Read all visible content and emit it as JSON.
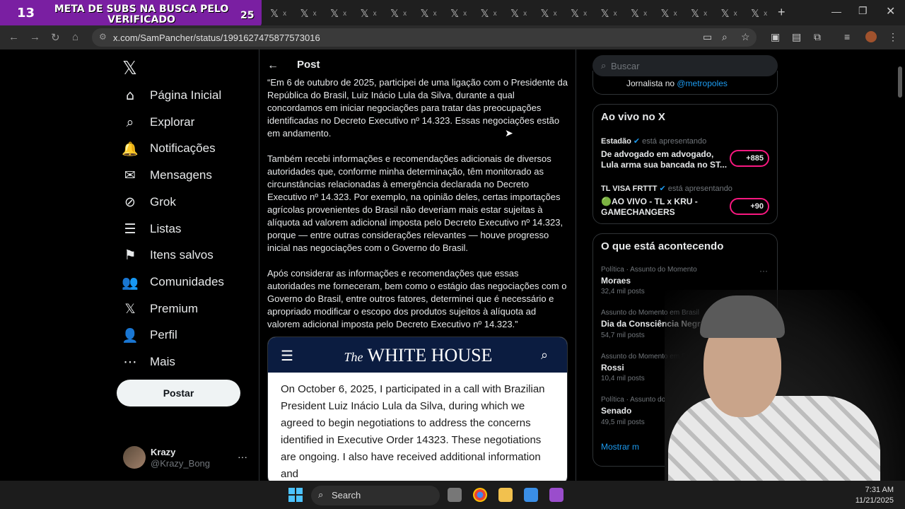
{
  "overlay": {
    "count": "13",
    "text": "META DE SUBS NA BUSCA PELO VERIFICADO",
    "goal": "25"
  },
  "tabs": {
    "icon": "x-logo-icon",
    "close": "x"
  },
  "browser": {
    "url": "x.com/SamPancher/status/1991627475877573016",
    "new_tab": "+",
    "icons": [
      "back-icon",
      "forward-icon",
      "reload-icon",
      "home-icon",
      "site-info-icon",
      "cast-icon",
      "zoom-icon",
      "star-icon",
      "extension-icon",
      "extension-icon",
      "puzzle-icon",
      "media-icon",
      "profile-icon",
      "menu-icon"
    ]
  },
  "sidebar": {
    "logo": "𝕏",
    "items": [
      {
        "label": "Página Inicial",
        "icon": "⌂"
      },
      {
        "label": "Explorar",
        "icon": "⌕"
      },
      {
        "label": "Notificações",
        "icon": "🔔"
      },
      {
        "label": "Mensagens",
        "icon": "✉"
      },
      {
        "label": "Grok",
        "icon": "⊘"
      },
      {
        "label": "Listas",
        "icon": "☰"
      },
      {
        "label": "Itens salvos",
        "icon": "⚑"
      },
      {
        "label": "Comunidades",
        "icon": "👥"
      },
      {
        "label": "Premium",
        "icon": "𝕏"
      },
      {
        "label": "Perfil",
        "icon": "👤"
      },
      {
        "label": "Mais",
        "icon": "⋯"
      }
    ],
    "post_button": "Postar",
    "account": {
      "name": "Krazy",
      "handle": "@Krazy_Bong",
      "more": "···"
    }
  },
  "post": {
    "header": "Post",
    "paragraphs": [
      "“Em 6 de outubro de 2025, participei de uma ligação com o Presidente da República do Brasil, Luiz Inácio Lula da Silva, durante a qual concordamos em iniciar negociações para tratar das preocupações identificadas no Decreto Executivo nº 14.323. Essas negociações estão em andamento.",
      "Também recebi informações e recomendações adicionais de diversos autoridades que, conforme minha determinação, têm monitorado as circunstâncias relacionadas à emergência declarada no Decreto Executivo nº 14.323. Por exemplo, na opinião deles, certas importações agrícolas provenientes do Brasil não deveriam mais estar sujeitas à alíquota ad valorem adicional imposta pelo Decreto Executivo nº 14.323, porque — entre outras considerações relevantes — houve progresso inicial nas negociações com o Governo do Brasil.",
      "Após considerar as informações e recomendações que essas autoridades me forneceram, bem como o estágio das negociações com o Governo do Brasil, entre outros fatores, determinei que é necessário e apropriado modificar o escopo dos produtos sujeitos à alíquota ad valorem adicional imposta pelo Decreto Executivo nº 14.323.”"
    ],
    "card": {
      "title_prefix": "The",
      "title": "WHITE HOUSE",
      "body": "On October 6, 2025, I participated in a call with Brazilian President Luiz Inácio Lula da Silva, during which we agreed to begin negotiations to address the concerns identified in Executive Order 14323.  These negotiations are ongoing. I also have received additional information and"
    }
  },
  "right": {
    "search_placeholder": "Buscar",
    "bio": {
      "prefix": "Jornalista no ",
      "link": "@metropoles"
    },
    "live": {
      "title": "Ao vivo no X",
      "items": [
        {
          "host": "Estadão",
          "status": "está apresentando",
          "text": "De advogado em advogado, Lula arma sua bancada no ST...",
          "badge": "+885"
        },
        {
          "host": "TL VISA FRTTT",
          "status": "está apresentando",
          "text": "🟢AO VIVO - TL x KRU - GAMECHANGERS",
          "badge": "+90"
        }
      ]
    },
    "trends": {
      "title": "O que está acontecendo",
      "items": [
        {
          "category": "Política · Assunto do Momento",
          "name": "Moraes",
          "count": "32,4 mil posts"
        },
        {
          "category": "Assunto do Momento em Brasil",
          "name": "Dia da Consciência Negra",
          "count": "54,7 mil posts"
        },
        {
          "category": "Assunto do Momento em Brasil",
          "name": "Rossi",
          "count": "10,4 mil posts"
        },
        {
          "category": "Política · Assunto do Momento",
          "name": "Senado",
          "count": "49,5 mil posts"
        }
      ],
      "show_more": "Mostrar m"
    }
  },
  "taskbar": {
    "search": "Search",
    "time": "7:31 AM",
    "date": "11/21/2025"
  },
  "colors": {
    "accent": "#1d9bf0",
    "overlay": "#7a1fa2",
    "live_ring": "#f91880",
    "wh_navy": "#0b1c40"
  }
}
